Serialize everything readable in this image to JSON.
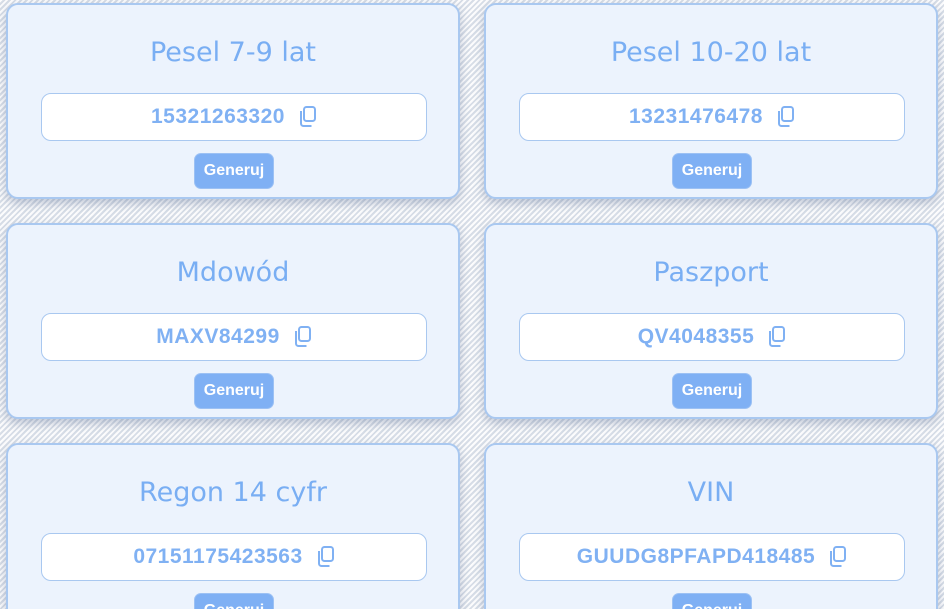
{
  "generate_label": "Generuj",
  "colors": {
    "accent": "#7fb0f4",
    "card_background": "#ecf3fd",
    "card_border": "#a9c8f0",
    "text": "#79aef3"
  },
  "icons": {
    "copy": "copy-icon"
  },
  "cards": [
    {
      "title": "Pesel 7-9 lat",
      "value": "15321263320"
    },
    {
      "title": "Pesel 10-20 lat",
      "value": "13231476478"
    },
    {
      "title": "Mdowód",
      "value": "MAXV84299"
    },
    {
      "title": "Paszport",
      "value": "QV4048355"
    },
    {
      "title": "Regon 14 cyfr",
      "value": "07151175423563"
    },
    {
      "title": "VIN",
      "value": "GUUDG8PFAPD418485"
    }
  ]
}
